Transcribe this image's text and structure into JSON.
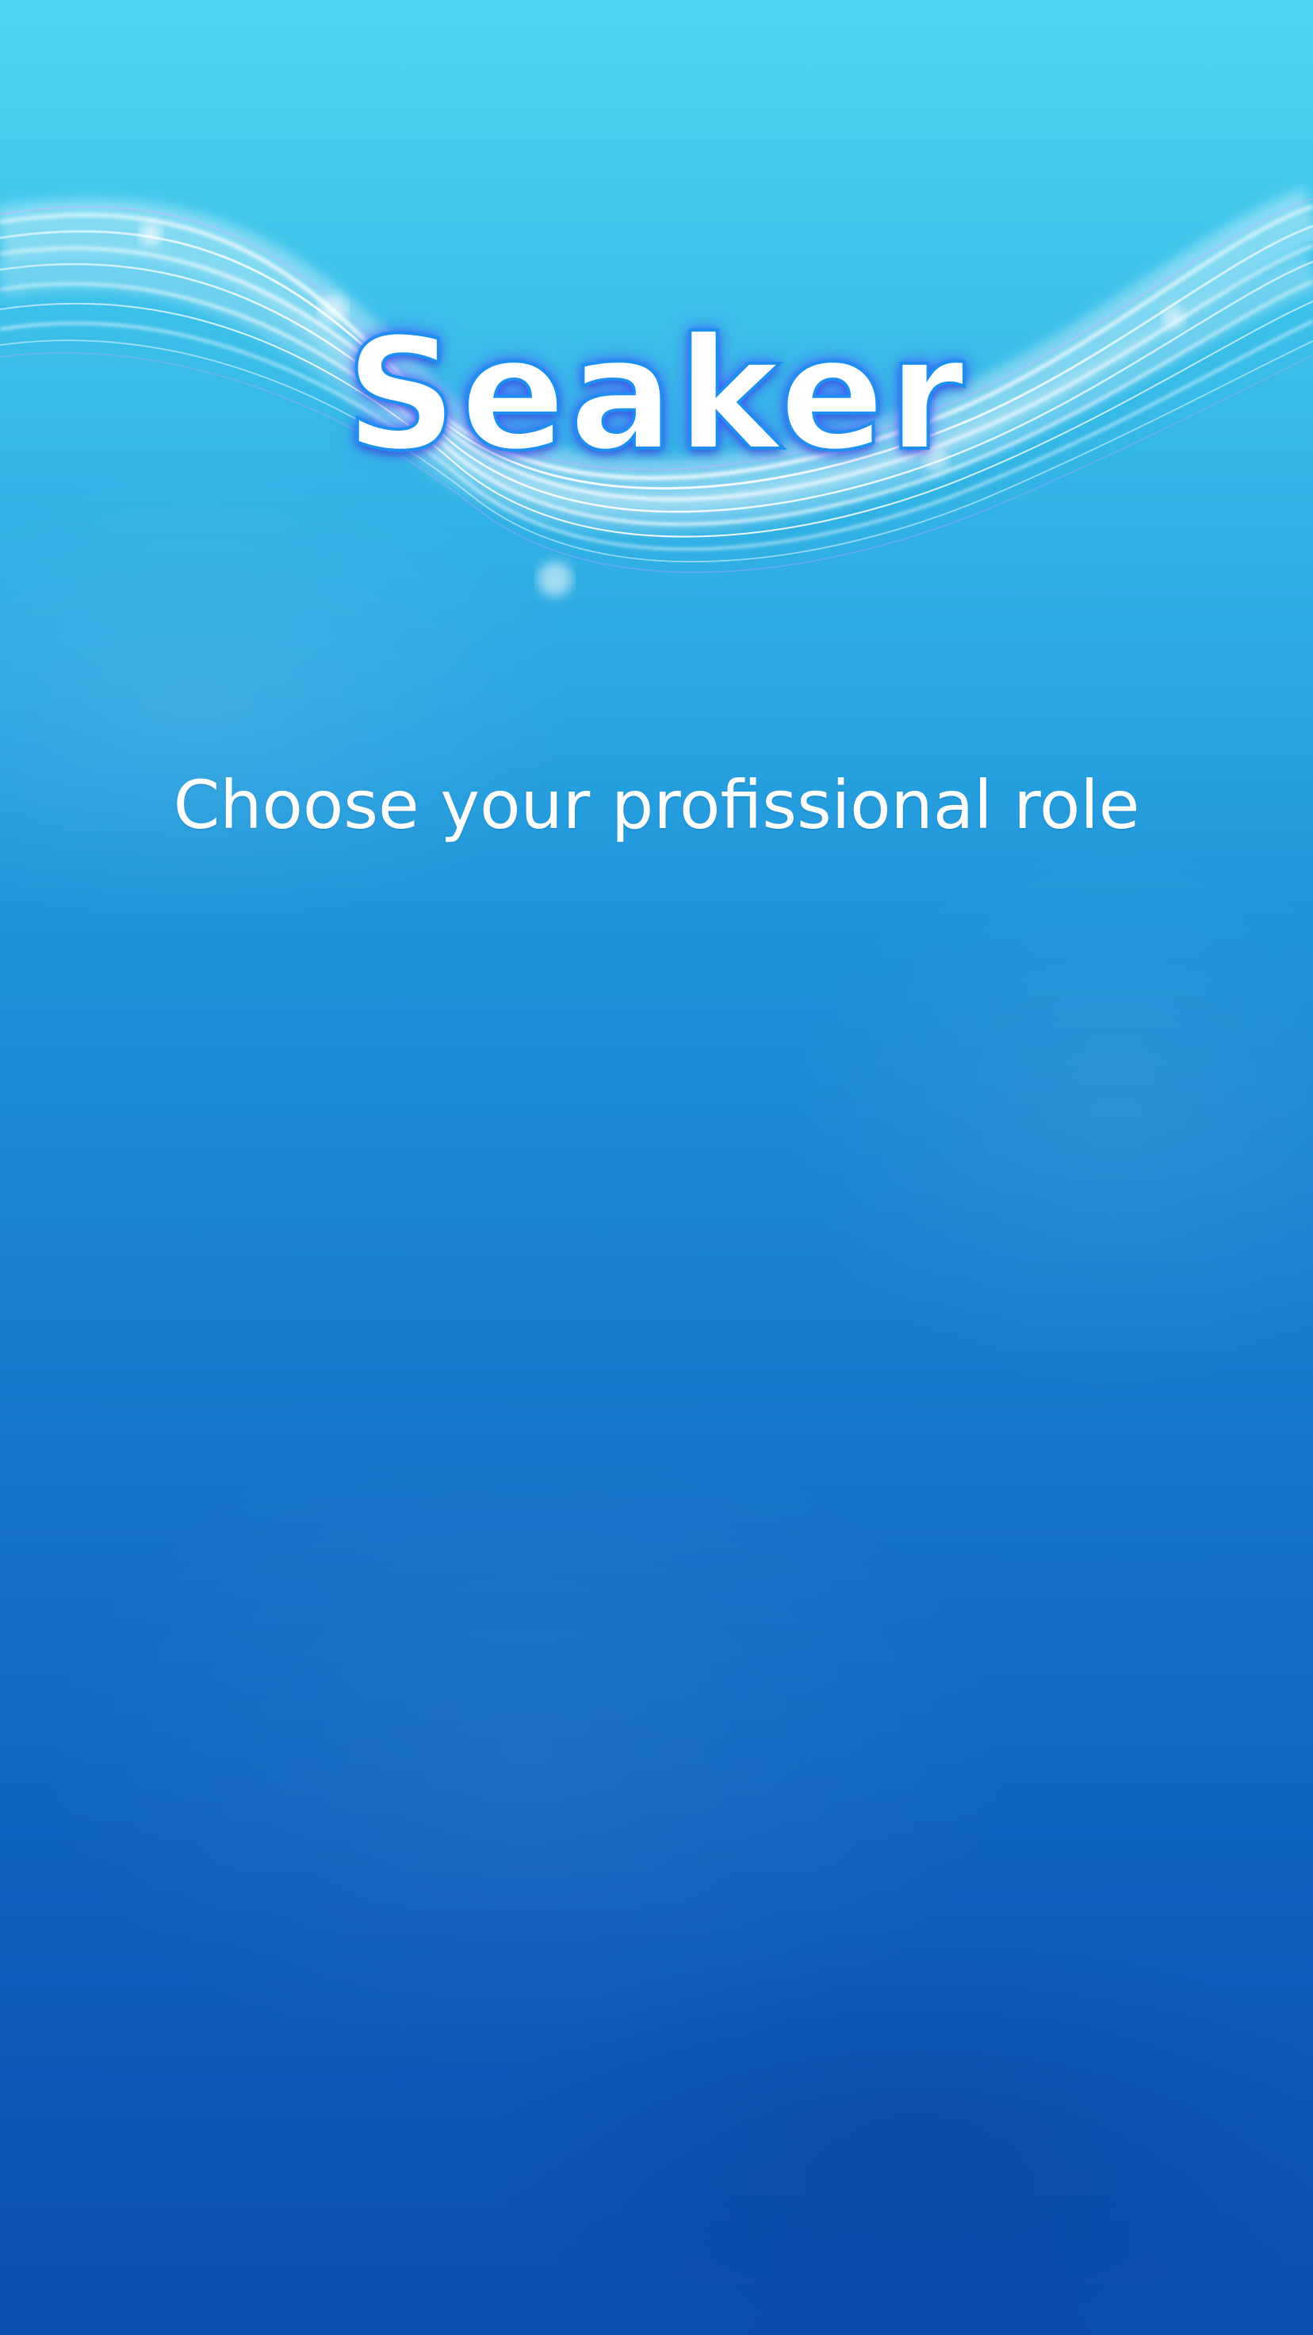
{
  "app": {
    "title": "Seaker"
  },
  "prompt": {
    "text": "Choose your profissional role"
  },
  "theme": {
    "background_top": "#4cd6f1",
    "background_bottom": "#0a4eaf",
    "title_glow": "#3c50ff",
    "text": "#ffffff"
  }
}
